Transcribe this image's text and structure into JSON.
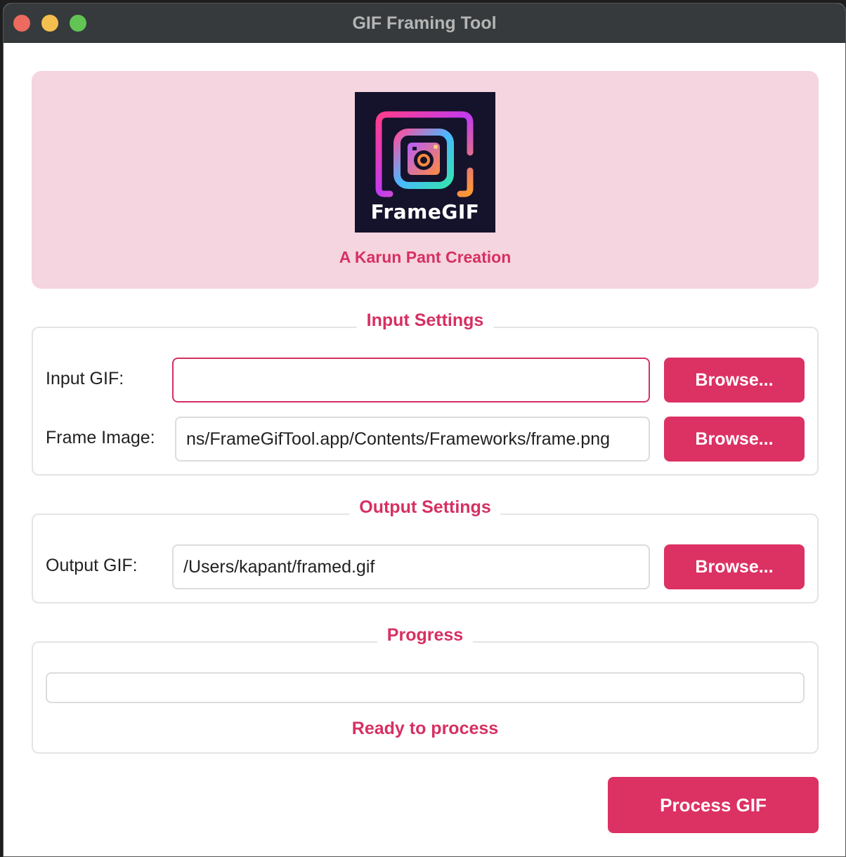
{
  "window": {
    "title": "GIF Framing Tool"
  },
  "banner": {
    "logo_text": "FrameGIF",
    "credit": "A Karun Pant Creation"
  },
  "input_settings": {
    "title": "Input Settings",
    "input_gif": {
      "label": "Input GIF:",
      "value": "",
      "button": "Browse..."
    },
    "frame_image": {
      "label": "Frame Image:",
      "value": "ns/FrameGifTool.app/Contents/Frameworks/frame.png",
      "button": "Browse..."
    }
  },
  "output_settings": {
    "title": "Output Settings",
    "output_gif": {
      "label": "Output GIF:",
      "value": "/Users/kapant/framed.gif",
      "button": "Browse..."
    }
  },
  "progress": {
    "title": "Progress",
    "value": 0,
    "status": "Ready to process"
  },
  "actions": {
    "process_label": "Process GIF"
  },
  "colors": {
    "accent": "#dc3163",
    "banner_bg": "#f5d5df",
    "titlebar": "#373a3c"
  }
}
